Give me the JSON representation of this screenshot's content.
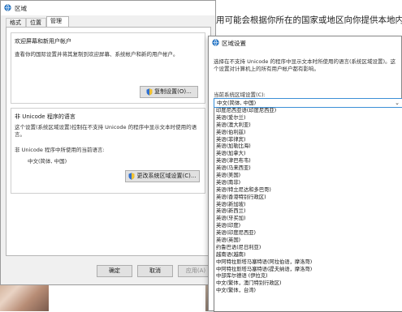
{
  "background": {
    "text": "用可能会根据你所在的国家或地区向你提供本地内容"
  },
  "region_window": {
    "title": "区域",
    "tabs": [
      "格式",
      "位置",
      "管理"
    ],
    "welcome_group": {
      "title": "欢迎屏幕和新用户帐户",
      "text": "查看你的国际设置并将其复制到欢迎屏幕、系统帐户和新的用户帐户。",
      "button": "复制设置(O)..."
    },
    "unicode_group": {
      "title": "非 Unicode 程序的语言",
      "text": "这个设置(系统区域设置)控制在不支持 Unicode 的程序中显示文本时使用的语言。",
      "current_label": "非 Unicode 程序中所使用的当前语言:",
      "current_value": "中文(简体, 中国)",
      "button": "更改系统区域设置(C)..."
    },
    "footer": {
      "ok": "确定",
      "cancel": "取消",
      "apply": "应用(A)"
    }
  },
  "region_settings_dialog": {
    "title": "区域设置",
    "description": "选择在不支持 Unicode 的程序中显示文本时所使用的语言(系统区域设置)。这个设置对计算机上的所有用户帐户都有影响。",
    "current_label": "当前系统区域设置(C):",
    "current_value": "中文(简体, 中国)",
    "options": [
      "印度尼西亚语(印度尼西亚)",
      "英语(爱尔兰)",
      "英语(澳大利亚)",
      "英语(伯利兹)",
      "英语(菲律宾)",
      "英语(加勒比海)",
      "英语(加拿大)",
      "英语(津巴布韦)",
      "英语(马来西亚)",
      "英语(美国)",
      "英语(南非)",
      "英语(特立尼达和多巴哥)",
      "英语(香港特别行政区)",
      "英语(新加坡)",
      "英语(新西兰)",
      "英语(牙买加)",
      "英语(印度)",
      "英语(印度尼西亚)",
      "英语(英国)",
      "约鲁巴语(尼日利亚)",
      "越南语(越南)",
      "中阿特拉斯塔马塞特语(阿拉伯语，摩洛哥)",
      "中阿特拉斯塔马塞特语(提夫纳语，摩洛哥)",
      "中部库尔德语 (伊拉克)",
      "中文(繁体，澳门特别行政区)",
      "中文(繁体，台湾)"
    ]
  }
}
